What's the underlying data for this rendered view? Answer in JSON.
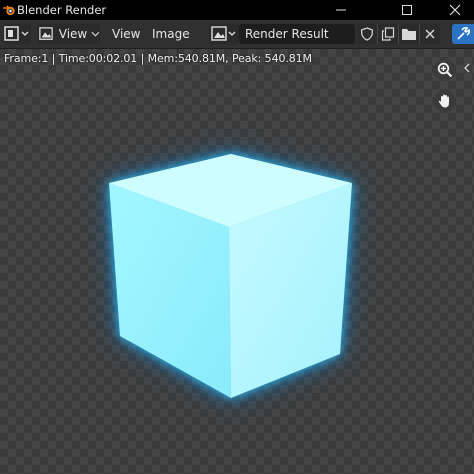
{
  "window": {
    "title": "Blender Render",
    "minimize_icon": "minimize-icon",
    "maximize_icon": "maximize-icon",
    "close_icon": "close-icon"
  },
  "header": {
    "editor_type_icon": "image-editor-icon",
    "view_icon": "image-icon",
    "view_menu_label": "View",
    "view_label": "View",
    "image_label": "Image",
    "image_browse_icon": "image-browse-icon",
    "image_name": "Render Result",
    "fake_user_icon": "shield-icon",
    "duplicate_icon": "duplicate-icon",
    "open_icon": "folder-icon",
    "unlink_icon": "x-icon",
    "tool_icon": "tool-icon"
  },
  "viewport": {
    "render_info": "Frame:1 | Time:00:02.01 | Mem:540.81M, Peak: 540.81M",
    "render_subject": "glowing-cube",
    "accent_color": "#8ff3ff",
    "glow_color": "#16b6ff",
    "zoom_icon": "zoom-icon",
    "pan_icon": "hand-icon",
    "sidebar_toggle_icon": "chevron-left-icon"
  }
}
